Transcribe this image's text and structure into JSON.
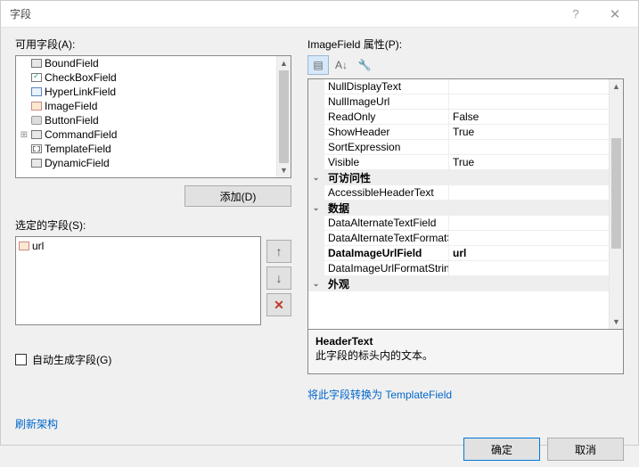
{
  "title": "字段",
  "left": {
    "available_label": "可用字段(A):",
    "fields": [
      {
        "icon": "bf",
        "label": "BoundField",
        "expand": false
      },
      {
        "icon": "cb",
        "label": "CheckBoxField",
        "expand": false
      },
      {
        "icon": "hl",
        "label": "HyperLinkField",
        "expand": false
      },
      {
        "icon": "im",
        "label": "ImageField",
        "expand": false
      },
      {
        "icon": "bt",
        "label": "ButtonField",
        "expand": false
      },
      {
        "icon": "bf",
        "label": "CommandField",
        "expand": true
      },
      {
        "icon": "tp",
        "label": "TemplateField",
        "expand": false
      },
      {
        "icon": "bf",
        "label": "DynamicField",
        "expand": false
      }
    ],
    "add_btn": "添加(D)",
    "selected_label": "选定的字段(S):",
    "selected_item": {
      "icon": "im",
      "label": "url"
    },
    "autogen_label": "自动生成字段(G)",
    "refresh_link": "刷新架构"
  },
  "right": {
    "props_label": "ImageField 属性(P):",
    "properties": [
      {
        "cat": false,
        "name": "NullDisplayText",
        "val": ""
      },
      {
        "cat": false,
        "name": "NullImageUrl",
        "val": ""
      },
      {
        "cat": false,
        "name": "ReadOnly",
        "val": "False"
      },
      {
        "cat": false,
        "name": "ShowHeader",
        "val": "True"
      },
      {
        "cat": false,
        "name": "SortExpression",
        "val": ""
      },
      {
        "cat": false,
        "name": "Visible",
        "val": "True"
      },
      {
        "cat": true,
        "name": "可访问性",
        "val": ""
      },
      {
        "cat": false,
        "name": "AccessibleHeaderText",
        "val": ""
      },
      {
        "cat": true,
        "name": "数据",
        "val": ""
      },
      {
        "cat": false,
        "name": "DataAlternateTextField",
        "val": ""
      },
      {
        "cat": false,
        "name": "DataAlternateTextFormatString",
        "val": ""
      },
      {
        "cat": false,
        "name": "DataImageUrlField",
        "val": "url",
        "sel": true
      },
      {
        "cat": false,
        "name": "DataImageUrlFormatString",
        "val": ""
      },
      {
        "cat": true,
        "name": "外观",
        "val": ""
      }
    ],
    "desc_title": "HeaderText",
    "desc_text": "此字段的标头内的文本。",
    "convert_link": "将此字段转换为 TemplateField"
  },
  "footer": {
    "ok": "确定",
    "cancel": "取消"
  }
}
